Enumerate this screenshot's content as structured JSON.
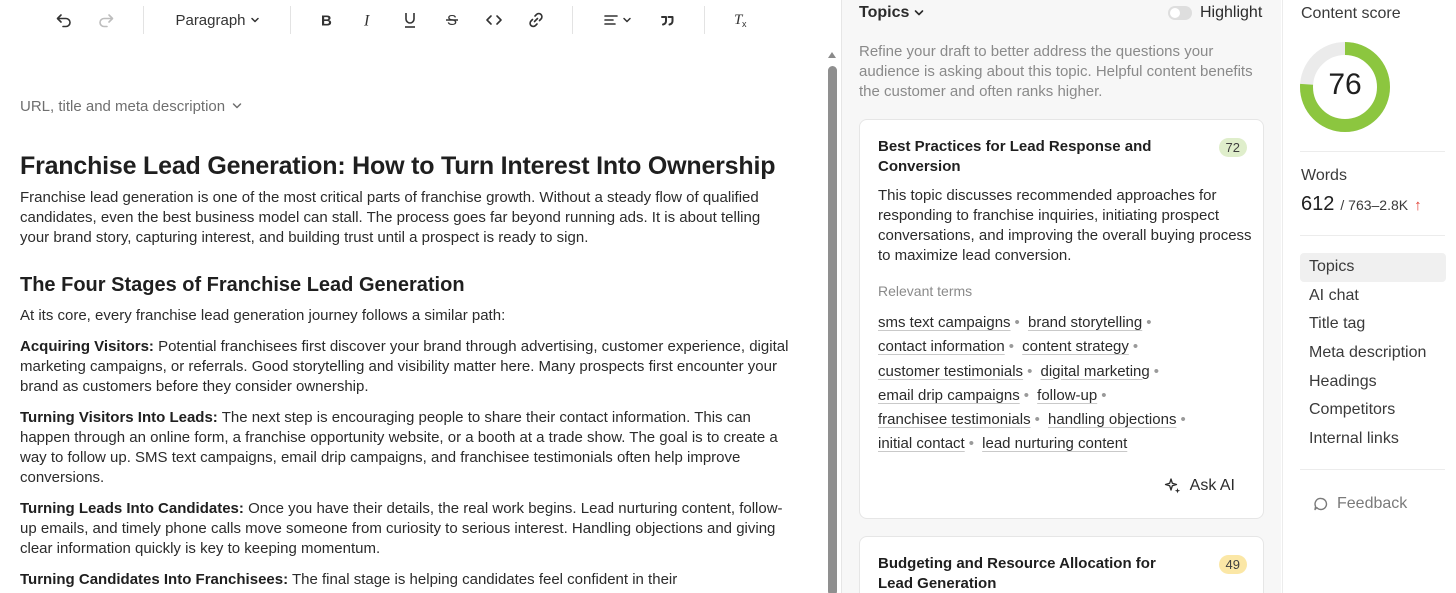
{
  "toolbar": {
    "block_style": "Paragraph",
    "icons": [
      "undo-icon",
      "redo-icon",
      "chevron-down-icon",
      "bold-icon",
      "italic-icon",
      "underline-icon",
      "strikethrough-icon",
      "code-icon",
      "link-icon",
      "align-icon",
      "quote-icon",
      "clear-format-icon"
    ]
  },
  "meta": {
    "toggle_label": "URL, title and meta description"
  },
  "document": {
    "title": "Franchise Lead Generation: How to Turn Interest Into Ownership",
    "intro": "Franchise lead generation is one of the most critical parts of franchise growth. Without a steady flow of qualified candidates, even the best business model can stall. The process goes far beyond running ads. It is about telling your brand story, capturing interest, and building trust until a prospect is ready to sign.",
    "h2": "The Four Stages of Franchise Lead Generation",
    "lead_in": "At its core, every franchise lead generation journey follows a similar path:",
    "stages": [
      {
        "label": "Acquiring Visitors:",
        "text": " Potential franchisees first discover your brand through advertising, customer experience, digital marketing campaigns, or referrals. Good storytelling and visibility matter here. Many prospects first encounter your brand as customers before they consider ownership."
      },
      {
        "label": "Turning Visitors Into Leads:",
        "text": " The next step is encouraging people to share their contact information. This can happen through an online form, a franchise opportunity website, or a booth at a trade show. The goal is to create a way to follow up. SMS text campaigns, email drip campaigns, and franchisee testimonials often help improve conversions."
      },
      {
        "label": "Turning Leads Into Candidates:",
        "text": " Once you have their details, the real work begins. Lead nurturing content, follow-up emails, and timely phone calls move someone from curiosity to serious interest. Handling objections and giving clear information quickly is key to keeping momentum."
      },
      {
        "label": "Turning Candidates Into Franchisees:",
        "text": " The final stage is helping candidates feel confident in their"
      }
    ]
  },
  "topics_panel": {
    "heading": "Topics",
    "highlight_label": "Highlight",
    "highlight_on": false,
    "description": "Refine your draft to better address the questions your audience is asking about this topic. Helpful content benefits the customer and often ranks higher.",
    "cards": [
      {
        "title": "Best Practices for Lead Response and Conversion",
        "score": "72",
        "badge_color": "#dfeecb",
        "description": "This topic discusses recommended approaches for responding to franchise inquiries, initiating prospect conversations, and improving the overall buying process to maximize lead conversion.",
        "terms_label": "Relevant terms",
        "terms": [
          "sms text campaigns",
          "brand storytelling",
          "contact information",
          "content strategy",
          "customer testimonials",
          "digital marketing",
          "email drip campaigns",
          "follow-up",
          "franchisee testimonials",
          "handling objections",
          "initial contact",
          "lead nurturing content"
        ],
        "ask_ai_label": "Ask AI"
      },
      {
        "title": "Budgeting and Resource Allocation for Lead Generation",
        "score": "49",
        "badge_color": "#fbe7a6"
      }
    ]
  },
  "sidebar": {
    "content_score_label": "Content score",
    "content_score": 76,
    "gauge_color": "#8cc63f",
    "gauge_track_color": "#ebebeb",
    "words_label": "Words",
    "words_count": "612",
    "words_range": "/ 763–2.8K",
    "words_trend_color": "#e03c31",
    "nav": [
      "Topics",
      "AI chat",
      "Title tag",
      "Meta description",
      "Headings",
      "Competitors",
      "Internal links"
    ],
    "active_nav": "Topics",
    "feedback_label": "Feedback"
  }
}
